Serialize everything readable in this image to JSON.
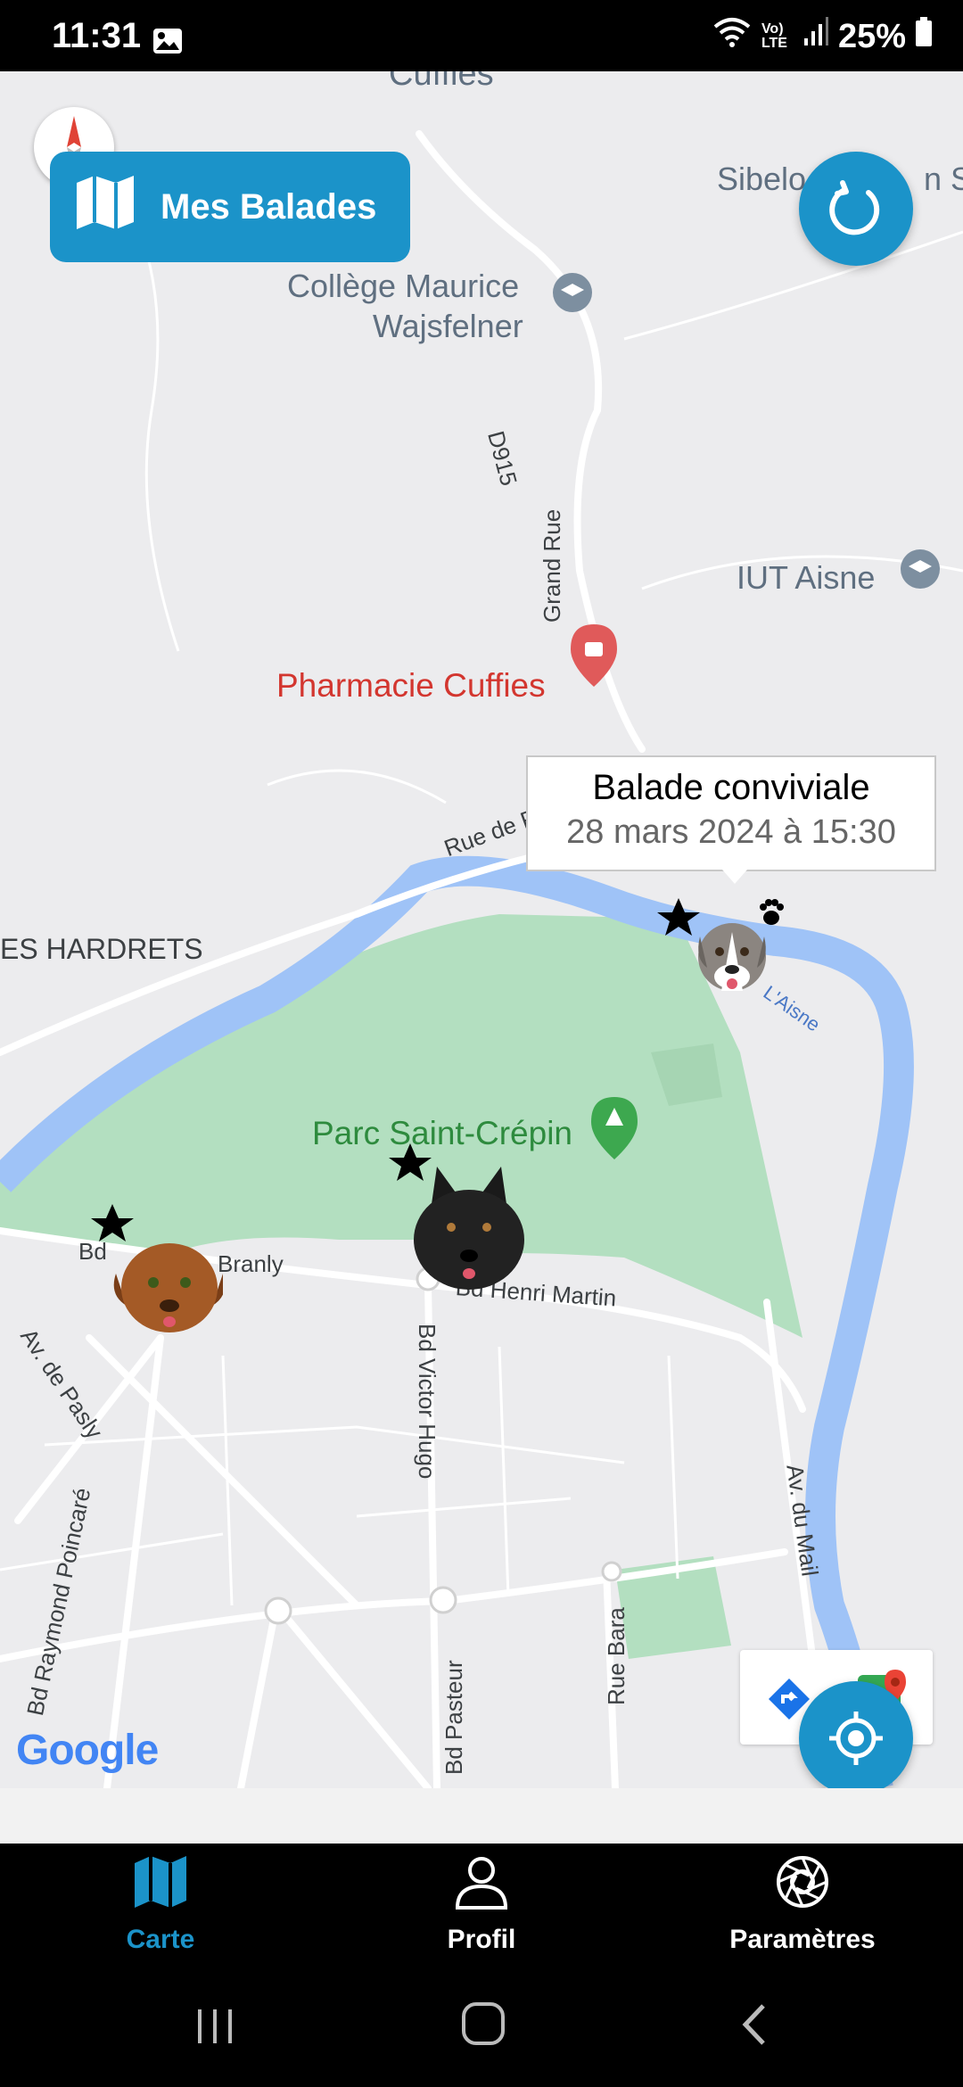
{
  "status_bar": {
    "time": "11:31",
    "battery": "25%",
    "icons": [
      "image-icon",
      "wifi-icon",
      "volte-icon",
      "signal-icon",
      "battery-icon"
    ],
    "network_label": "Vo) LTE"
  },
  "map": {
    "labels": {
      "cuffies": "Cuffies",
      "sibelo": "Sibelo",
      "sibelo_end": "n Sc",
      "college_line1": "Collège Maurice",
      "college_line2": "Wajsfelner",
      "d915": "D915",
      "grand_rue": "Grand Rue",
      "iut": "IUT Aisne",
      "pharmacie": "Pharmacie Cuffies",
      "rue_de": "Rue de F",
      "hardrets": "ES HARDRETS",
      "parc": "Parc Saint-Crépin",
      "laisne": "L'Aisne",
      "bd_short": "Bd",
      "branly": "Branly",
      "henri_martin": "Bd Henri Martin",
      "pasly": "Av. de Pasly",
      "victor_hugo": "Bd Victor Hugo",
      "poincare": "Bd Raymond Poincaré",
      "av_mail": "Av. du Mail",
      "rue_bara": "Rue Bara",
      "pasteur": "Bd Pasteur"
    },
    "google": "Google"
  },
  "mes_balades": {
    "label": "Mes Balades"
  },
  "callout": {
    "title": "Balade conviviale",
    "date": "28 mars 2024 à 15:30"
  },
  "colors": {
    "accent": "#1b93c9",
    "river": "#9fc3f7",
    "park": "#b3dfc0",
    "land": "#ececee"
  },
  "bottom_nav": {
    "items": [
      {
        "label": "Carte",
        "icon": "map-icon",
        "active": true
      },
      {
        "label": "Profil",
        "icon": "person-icon",
        "active": false
      },
      {
        "label": "Paramètres",
        "icon": "aperture-icon",
        "active": false
      }
    ]
  }
}
